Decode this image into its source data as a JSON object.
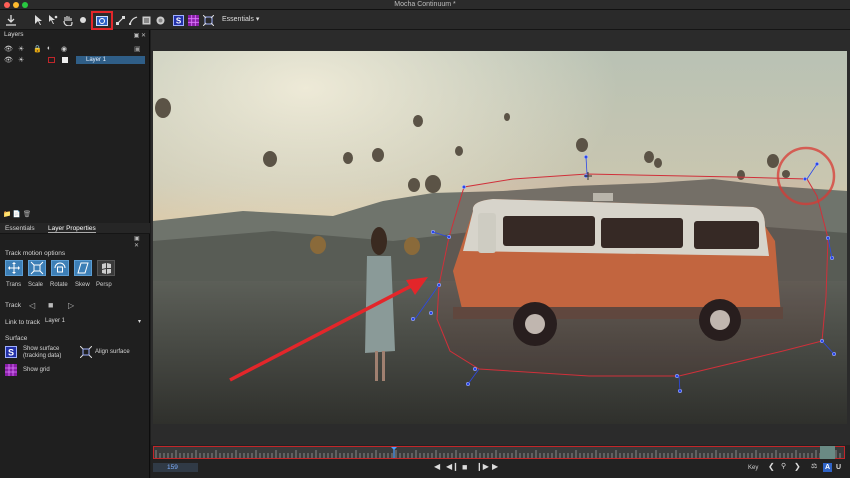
{
  "app": {
    "title": "Mocha Continuum *"
  },
  "toolbar": {
    "workspace_label": "Essentials",
    "tools": [
      {
        "name": "export-icon"
      },
      {
        "name": "select-tool-icon"
      },
      {
        "name": "pick-tool-icon"
      },
      {
        "name": "hand-tool-icon"
      },
      {
        "name": "zoom-tool-icon"
      },
      {
        "name": "planar-tracker-icon",
        "selected": true
      },
      {
        "name": "x-spline-tool-icon"
      },
      {
        "name": "bezier-tool-icon"
      },
      {
        "name": "rectangle-tool-icon"
      },
      {
        "name": "circle-tool-icon"
      },
      {
        "name": "surface-icon"
      },
      {
        "name": "grid-icon"
      },
      {
        "name": "align-surface-icon"
      }
    ]
  },
  "layers_panel": {
    "title": "Layers",
    "layers": [
      {
        "name": "Layer 1",
        "color": "#c0262a"
      }
    ]
  },
  "properties": {
    "tabs": [
      {
        "label": "Essentials",
        "active": false
      },
      {
        "label": "Layer Properties",
        "active": true
      }
    ],
    "track_motion_title": "Track motion options",
    "motion_options": [
      {
        "label": "Trans",
        "on": true
      },
      {
        "label": "Scale",
        "on": true
      },
      {
        "label": "Rotate",
        "on": true
      },
      {
        "label": "Skew",
        "on": true
      },
      {
        "label": "Persp",
        "on": false
      }
    ],
    "track_label": "Track",
    "link_to_track_label": "Link to track",
    "link_to_track_value": "Layer 1",
    "surface_title": "Surface",
    "show_surface_label": "Show surface",
    "show_surface_sub": "(tracking data)",
    "align_surface_label": "Align surface",
    "show_grid_label": "Show grid"
  },
  "timeline": {
    "current_frame": "159",
    "key_label": "Key"
  },
  "colors": {
    "accent_red": "#e3262a",
    "spline_blue": "#2c48e8",
    "layer_highlight": "#2f5e87"
  }
}
